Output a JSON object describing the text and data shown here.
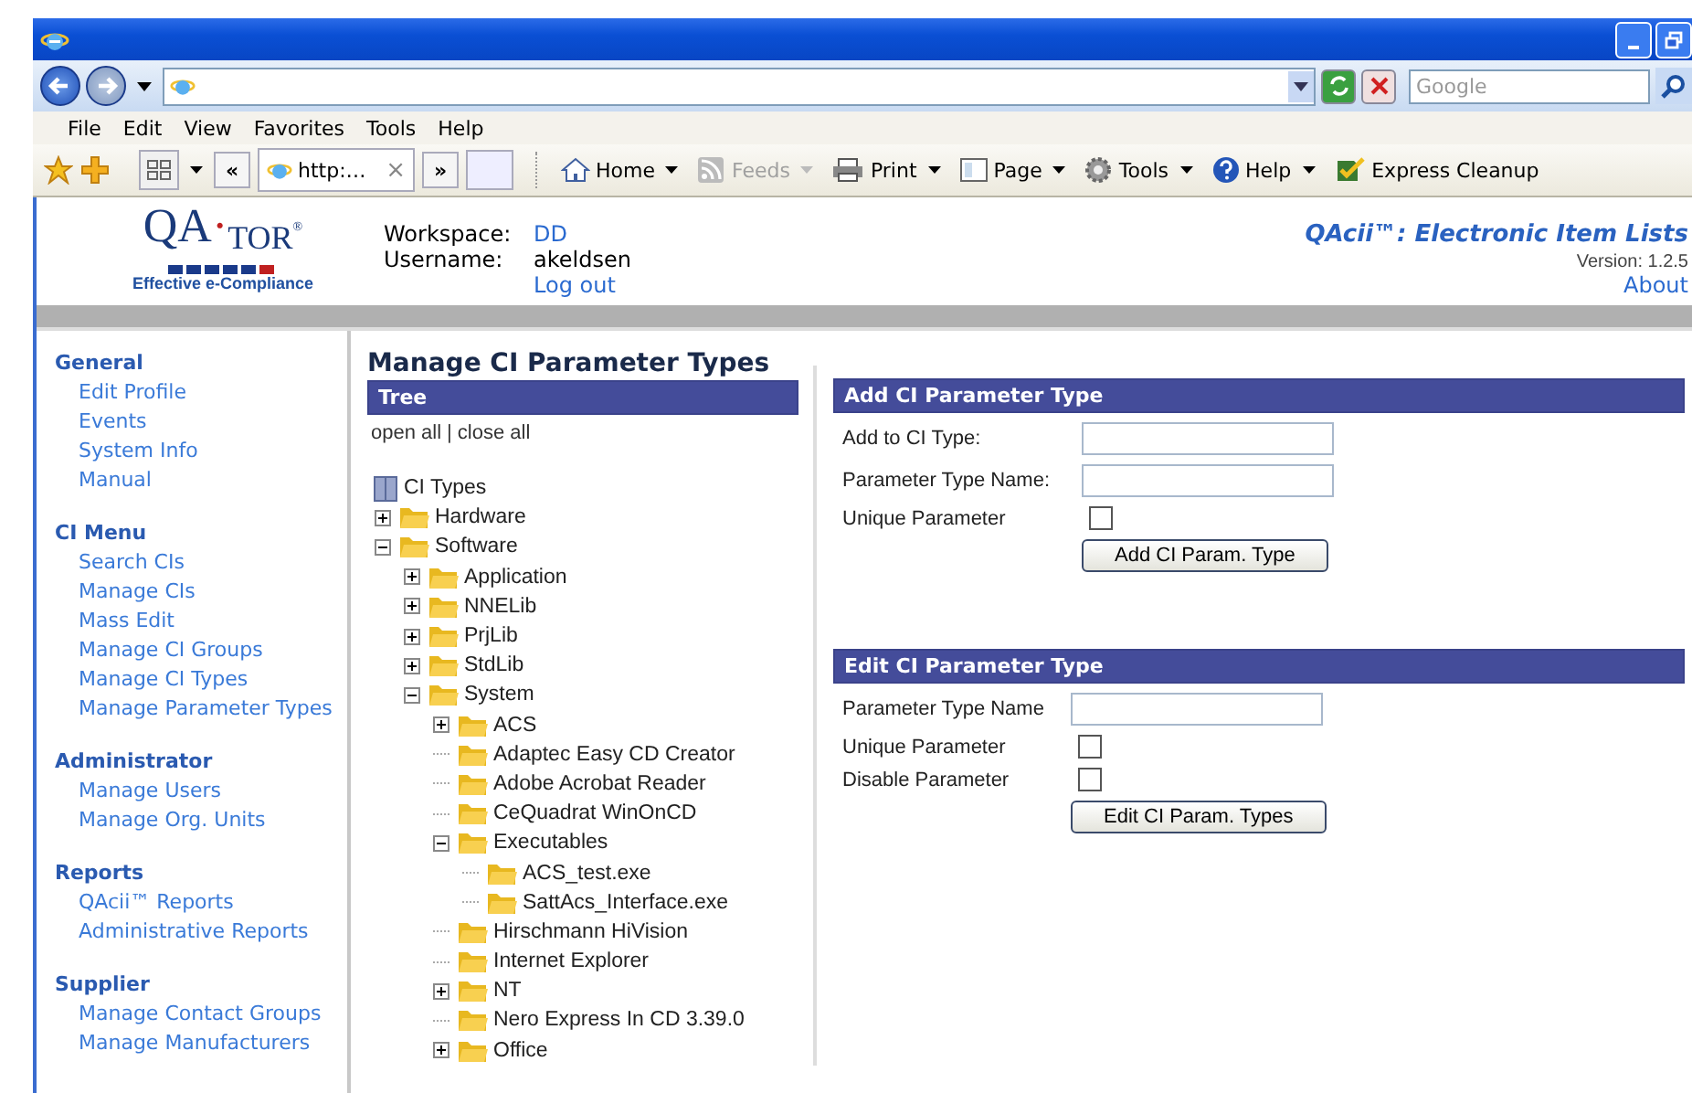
{
  "browser": {
    "search_placeholder": "Google",
    "menu": [
      "File",
      "Edit",
      "View",
      "Favorites",
      "Tools",
      "Help"
    ],
    "tab": {
      "label": "http:…",
      "close": "×"
    },
    "tab_prev": "«",
    "tab_next": "»",
    "commands": [
      {
        "label": "Home",
        "dropdown": true,
        "disabled": false
      },
      {
        "label": "Feeds",
        "dropdown": true,
        "disabled": true
      },
      {
        "label": "Print",
        "dropdown": true,
        "disabled": false
      },
      {
        "label": "Page",
        "dropdown": true,
        "disabled": false
      },
      {
        "label": "Tools",
        "dropdown": true,
        "disabled": false
      },
      {
        "label": "Help",
        "dropdown": true,
        "disabled": false
      },
      {
        "label": "Express Cleanup",
        "dropdown": false,
        "disabled": false
      }
    ]
  },
  "header": {
    "logo": {
      "main": "QA",
      "dot": "·",
      "rest": "TOR",
      "reg": "®",
      "tagline": "Effective e-Compliance"
    },
    "workspace_label": "Workspace:",
    "workspace": "DD",
    "username_label": "Username:",
    "username": "akeldsen",
    "logout": "Log out",
    "app_title": "QAcii™: Electronic Item Lists",
    "version": "Version: 1.2.5",
    "about": "About"
  },
  "nav": [
    {
      "heading": "General",
      "items": [
        "Edit Profile",
        "Events",
        "System Info",
        "Manual"
      ]
    },
    {
      "heading": "CI Menu",
      "items": [
        "Search CIs",
        "Manage CIs",
        "Mass Edit",
        "Manage CI Groups",
        "Manage CI Types",
        "Manage Parameter Types"
      ]
    },
    {
      "heading": "Administrator",
      "items": [
        "Manage Users",
        "Manage Org. Units"
      ]
    },
    {
      "heading": "Reports",
      "items": [
        "QAcii™ Reports",
        "Administrative Reports"
      ]
    },
    {
      "heading": "Supplier",
      "items": [
        "Manage Contact Groups",
        "Manage Manufacturers"
      ]
    }
  ],
  "page_title": "Manage CI Parameter Types",
  "tree": {
    "title": "Tree",
    "open_all": "open all",
    "separator": "|",
    "close_all": "close all",
    "root": "CI Types",
    "children": [
      {
        "label": "Hardware",
        "kind": "branch",
        "expanded": false
      },
      {
        "label": "Software",
        "kind": "branch",
        "expanded": true,
        "children": [
          {
            "label": "Application",
            "kind": "branch",
            "expanded": false
          },
          {
            "label": "NNELib",
            "kind": "branch",
            "expanded": false
          },
          {
            "label": "PrjLib",
            "kind": "branch",
            "expanded": false
          },
          {
            "label": "StdLib",
            "kind": "branch",
            "expanded": false
          },
          {
            "label": "System",
            "kind": "branch",
            "expanded": true,
            "children": [
              {
                "label": "ACS",
                "kind": "branch",
                "expanded": false
              },
              {
                "label": "Adaptec Easy CD Creator",
                "kind": "leaf"
              },
              {
                "label": "Adobe Acrobat Reader",
                "kind": "leaf"
              },
              {
                "label": "CeQuadrat WinOnCD",
                "kind": "leaf"
              },
              {
                "label": "Executables",
                "kind": "branch",
                "expanded": true,
                "children": [
                  {
                    "label": "ACS_test.exe",
                    "kind": "leaf"
                  },
                  {
                    "label": "SattAcs_Interface.exe",
                    "kind": "leaf"
                  }
                ]
              },
              {
                "label": "Hirschmann HiVision",
                "kind": "leaf"
              },
              {
                "label": "Internet Explorer",
                "kind": "leaf"
              },
              {
                "label": "NT",
                "kind": "branch",
                "expanded": false
              },
              {
                "label": "Nero Express In CD 3.39.0",
                "kind": "leaf"
              },
              {
                "label": "Office",
                "kind": "branch",
                "expanded": false
              }
            ]
          }
        ]
      }
    ]
  },
  "forms": [
    {
      "title": "Add CI Parameter Type",
      "fields": [
        {
          "label": "Add to CI Type:",
          "kind": "text"
        },
        {
          "label": "Parameter Type Name:",
          "kind": "text"
        },
        {
          "label": "Unique Parameter",
          "kind": "checkbox",
          "checked": false
        }
      ],
      "button": "Add CI Param. Type"
    },
    {
      "title": "Edit CI Parameter Type",
      "fields": [
        {
          "label": "Parameter Type Name",
          "kind": "text"
        },
        {
          "label": "Unique Parameter",
          "kind": "checkbox",
          "checked": false
        },
        {
          "label": "Disable Parameter",
          "kind": "checkbox",
          "checked": false
        }
      ],
      "button": "Edit CI Param. Types"
    }
  ]
}
